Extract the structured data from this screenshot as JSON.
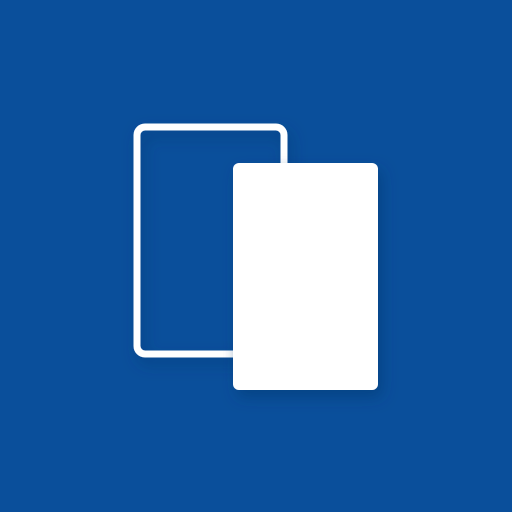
{
  "app": {
    "icon": "switch-cards-icon",
    "colors": {
      "background": "#0a4f9b",
      "foreground": "#ffffff",
      "shadow": "#063a73"
    }
  }
}
